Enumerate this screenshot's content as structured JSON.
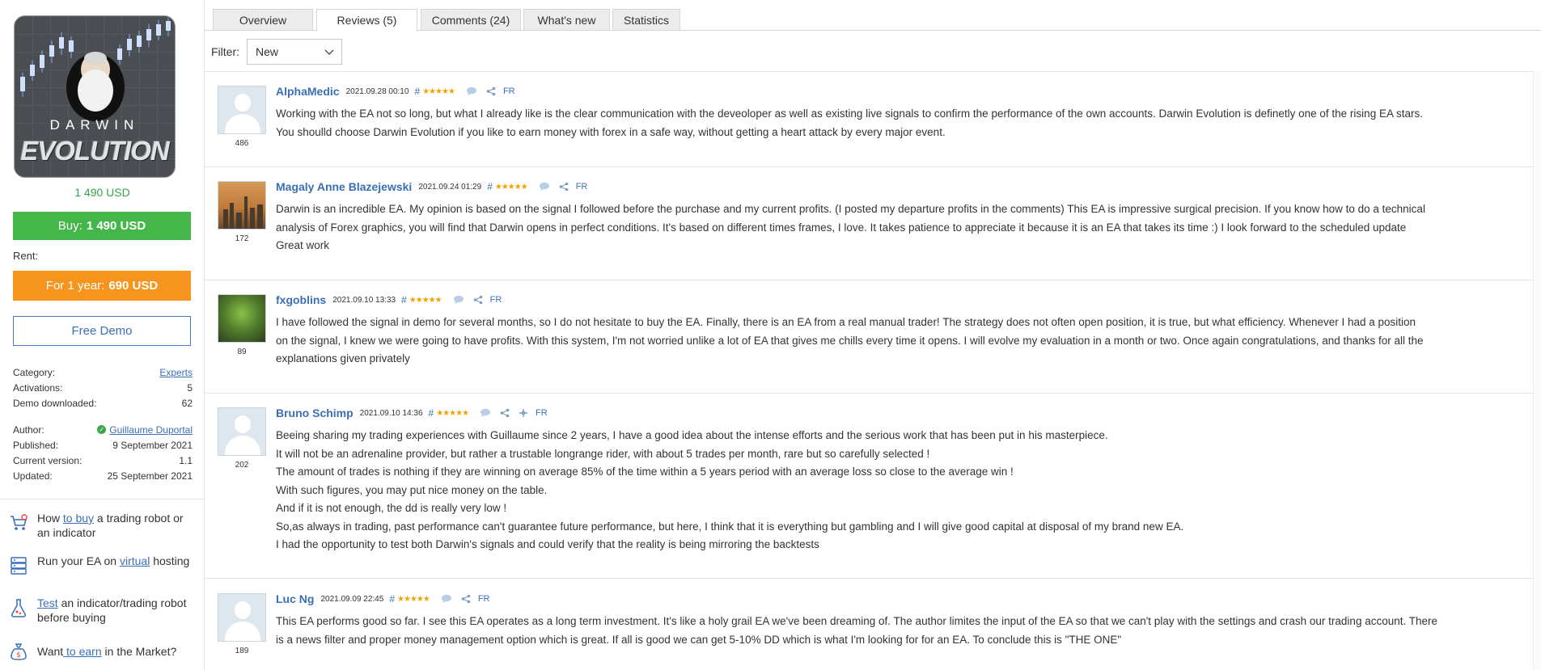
{
  "product": {
    "image_title": "DARWIN",
    "image_subtitle": "EVOLUTION",
    "price": "1 490 USD",
    "buy_label": "Buy:",
    "buy_price": "1 490 USD",
    "rent_label": "Rent:",
    "rent_period": "For 1 year:",
    "rent_price": "690 USD",
    "demo_label": "Free Demo"
  },
  "info": {
    "category_label": "Category:",
    "category_value": "Experts",
    "activations_label": "Activations:",
    "activations_value": "5",
    "demo_downloaded_label": "Demo downloaded:",
    "demo_downloaded_value": "62",
    "author_label": "Author:",
    "author_value": "Guillaume Duportal",
    "published_label": "Published:",
    "published_value": "9 September 2021",
    "version_label": "Current version:",
    "version_value": "1.1",
    "updated_label": "Updated:",
    "updated_value": "25 September 2021"
  },
  "promos": [
    {
      "pre": "How ",
      "link": "to buy",
      "post": " a trading robot or an indicator",
      "icon": "cart-icon"
    },
    {
      "pre": "Run your EA on ",
      "link": "virtual",
      "post": " hosting",
      "icon": "server-icon"
    },
    {
      "pre": "",
      "link": "Test",
      "post": " an indicator/trading robot before buying",
      "icon": "flask-icon"
    },
    {
      "pre": "Want",
      "link": " to earn",
      "post": " in the Market?",
      "icon": "money-bag-icon"
    }
  ],
  "tabs": [
    "Overview",
    "Reviews (5)",
    "Comments (24)",
    "What's new",
    "Statistics"
  ],
  "filter": {
    "label": "Filter:",
    "value": "New"
  },
  "reviews": [
    {
      "name": "AlphaMedic",
      "date": "2021.09.28 00:10",
      "hash": "#",
      "stars": "★★★★★",
      "rating": "486",
      "fr": "FR",
      "lines": [
        "Working with the EA not so long, but what I already like is the clear communication with the deveoloper as well as existing live signals to confirm the performance of the own accounts. Darwin Evolution is definetly one of the rising EA stars.",
        "You shoulld choose Darwin Evolution if you like to earn money with forex in a safe way, without getting a heart attack by every major event."
      ]
    },
    {
      "name": "Magaly Anne Blazejewski",
      "date": "2021.09.24 01:29",
      "hash": "#",
      "stars": "★★★★★",
      "rating": "172",
      "fr": "FR",
      "lines": [
        "Darwin is an incredible EA. My opinion is based on the signal I followed before the purchase and my current profits. (I posted my departure profits in the comments) This EA is impressive surgical precision. If you know how to do a technical",
        "analysis of Forex graphics, you will find that Darwin opens in perfect conditions. It's based on different times frames, I love. It takes patience to appreciate it because it is an EA that takes its time :) I look forward to the scheduled update",
        "Great work"
      ]
    },
    {
      "name": "fxgoblins",
      "date": "2021.09.10 13:33",
      "hash": "#",
      "stars": "★★★★★",
      "rating": "89",
      "fr": "FR",
      "lines": [
        "I have followed the signal in demo for several months, so I do not hesitate to buy the EA. Finally, there is an EA from a real manual trader! The strategy does not often open position, it is true, but what efficiency. Whenever I had a position",
        "on the signal, I knew we were going to have profits. With this system, I'm not worried unlike a lot of EA that gives me chills every time it opens. I will evolve my evaluation in a month or two. Once again congratulations, and thanks for all the",
        "explanations given privately"
      ]
    },
    {
      "name": "Bruno Schimp",
      "date": "2021.09.10 14:36",
      "hash": "#",
      "stars": "★★★★★",
      "rating": "202",
      "fr": "FR",
      "lines": [
        "Beeing sharing my trading experiences with Guillaume since 2 years, I have a good idea about the intense efforts and the serious work that has been put in his masterpiece.",
        "It will not be an adrenaline provider, but rather a trustable longrange rider, with about 5 trades per month, rare but so carefully selected !",
        "The amount of trades is nothing if they are winning on average 85% of the time within a 5 years period with an average loss so close to the average win !",
        "With such figures, you may put nice money on the table.",
        "And if it is not enough, the dd is really very low !",
        "So,as always in trading, past performance can't guarantee future performance, but here, I think that it is everything but gambling and I will give good capital at disposal of my brand new EA.",
        "I had the opportunity to test both Darwin's signals and could verify that the reality is being mirroring the backtests"
      ]
    },
    {
      "name": "Luc Ng",
      "date": "2021.09.09 22:45",
      "hash": "#",
      "stars": "★★★★★",
      "rating": "189",
      "fr": "FR",
      "lines": [
        "This EA performs good so far. I see this EA operates as a long term investment. It's like a holy grail EA we've been dreaming of. The author limites the input of the EA so that we can't play with the settings and crash our trading account. There",
        "is a news filter and proper money management option which is great. If all is good we can get 5-10% DD which is what I'm looking for for an EA. To conclude this is \"THE ONE\""
      ]
    }
  ]
}
